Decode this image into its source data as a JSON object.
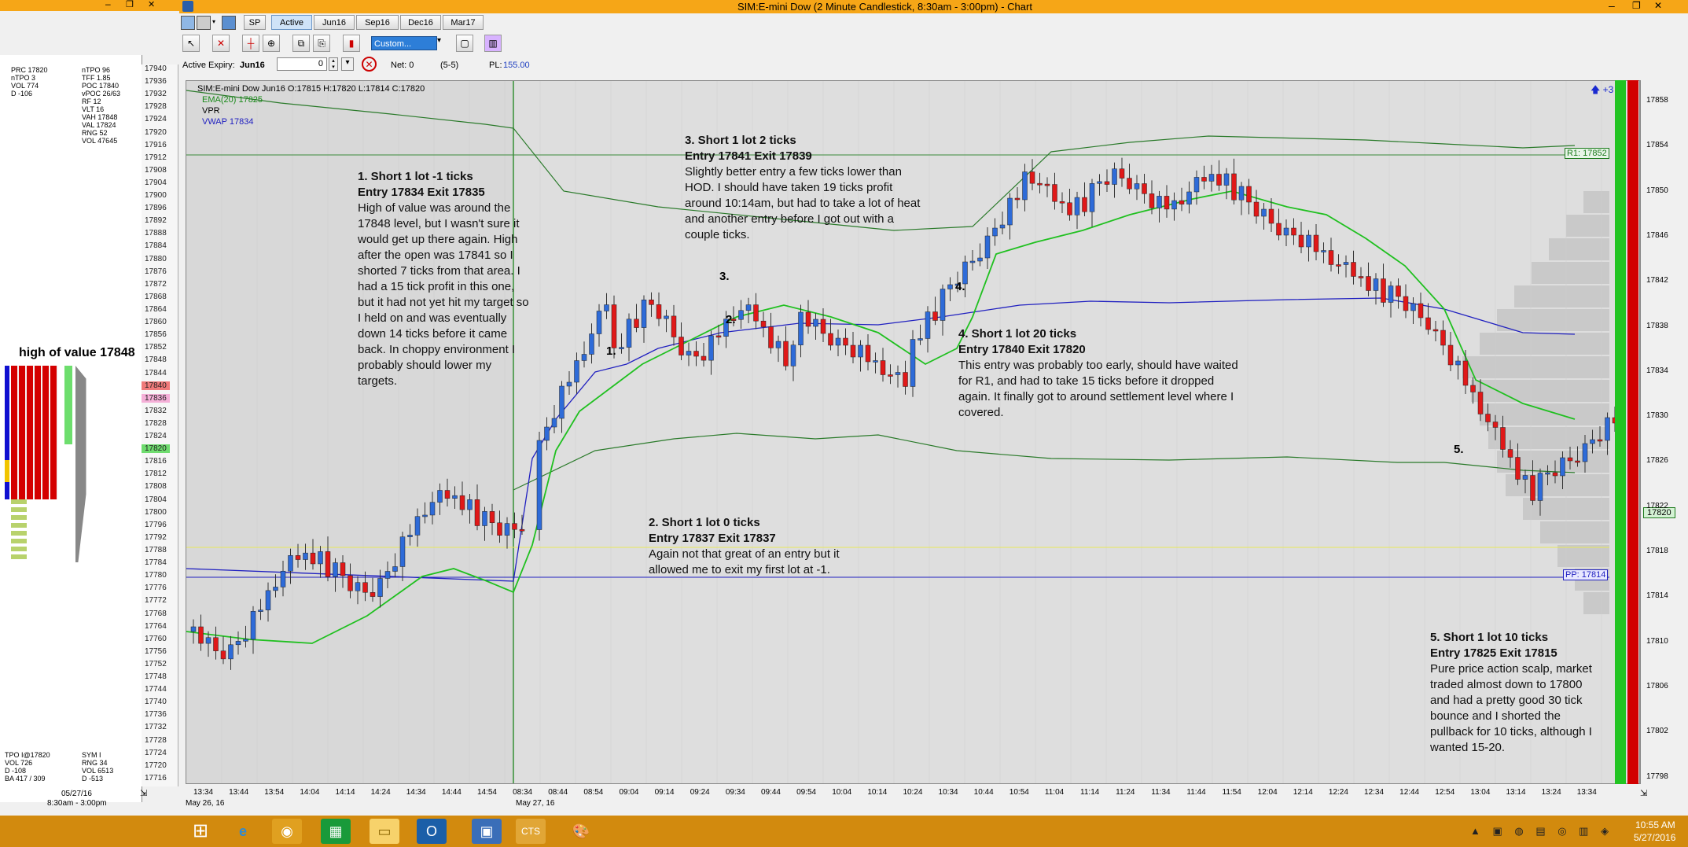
{
  "window": {
    "title": "SIM:E-mini Dow (2 Minute Candlestick, 8:30am - 3:00pm) - Chart"
  },
  "toolbar": {
    "symbol": "SP",
    "tabs": [
      "Active",
      "Jun16",
      "Sep16",
      "Dec16",
      "Mar17"
    ],
    "template_select": "Custom...",
    "active_expiry_label": "Active Expiry:",
    "active_expiry_value": "Jun16",
    "qty_value": "0",
    "net_label": "Net: 0",
    "position": "(5-5)",
    "pl_label": "PL:",
    "pl_value": "155.00"
  },
  "left_panel": {
    "stats_left": [
      "PRC  17820",
      "nTPO  3",
      "VOL  774",
      "D  -106"
    ],
    "stats_right": [
      "nTPO  96",
      "TFF  1.85",
      "POC  17840",
      "vPOC  26/63",
      "RF  12",
      "VLT  16",
      "VAH  17848",
      "VAL  17824",
      "RNG  52",
      "VOL  47645"
    ],
    "high_of_value": "high of value 17848",
    "bottom_left": [
      "TPO  I@17820",
      "VOL  726",
      "D  -108",
      "BA  417 / 309"
    ],
    "bottom_right": [
      "SYM  I",
      "RNG  34",
      "VOL  6513",
      "D  -513"
    ],
    "date": "05/27/16",
    "session": "8:30am - 3:00pm"
  },
  "ladder": {
    "prices": [
      "17940",
      "17936",
      "17932",
      "17928",
      "17924",
      "17920",
      "17916",
      "17912",
      "17908",
      "17904",
      "17900",
      "17896",
      "17892",
      "17888",
      "17884",
      "17880",
      "17876",
      "17872",
      "17868",
      "17864",
      "17860",
      "17856",
      "17852",
      "17848",
      "17844",
      "17840",
      "17836",
      "17832",
      "17828",
      "17824",
      "17820",
      "17816",
      "17812",
      "17808",
      "17804",
      "17800",
      "17796",
      "17792",
      "17788",
      "17784",
      "17780",
      "17776",
      "17772",
      "17768",
      "17764",
      "17760",
      "17756",
      "17752",
      "17748",
      "17744",
      "17740",
      "17736",
      "17732",
      "17728",
      "17724",
      "17720",
      "17716"
    ],
    "highlight_red": "17840",
    "highlight_pink": "17836",
    "highlight_green": "17820"
  },
  "chart_header": {
    "ohlc": "SIM:E-mini Dow Jun16 O:17815 H:17820 L:17814 C:17820",
    "ema": "EMA(20)  17825",
    "vpr": "VPR",
    "vwap": "VWAP  17834"
  },
  "price_axis": [
    "17858",
    "17854",
    "17850",
    "17846",
    "17842",
    "17838",
    "17834",
    "17830",
    "17826",
    "17822",
    "17818",
    "17814",
    "17810",
    "17806",
    "17802",
    "17798"
  ],
  "axis_badges": {
    "r1": "R1: 17852",
    "pp": "PP: 17814",
    "last": "17820"
  },
  "time_axis": [
    "13:34",
    "13:44",
    "13:54",
    "14:04",
    "14:14",
    "14:24",
    "14:34",
    "14:44",
    "14:54",
    "08:34",
    "08:44",
    "08:54",
    "09:04",
    "09:14",
    "09:24",
    "09:34",
    "09:44",
    "09:54",
    "10:04",
    "10:14",
    "10:24",
    "10:34",
    "10:44",
    "10:54",
    "11:04",
    "11:14",
    "11:24",
    "11:34",
    "11:44",
    "11:54",
    "12:04",
    "12:14",
    "12:24",
    "12:34",
    "12:44",
    "12:54",
    "13:04",
    "13:14",
    "13:24",
    "13:34"
  ],
  "date_labels": [
    "May 26, 16",
    "May 27, 16"
  ],
  "trade_markers": [
    "1.",
    "2.",
    "3.",
    "4.",
    "5."
  ],
  "annotations": [
    {
      "title": "1. Short 1 lot -1 ticks",
      "entry": "Entry 17834  Exit 17835",
      "body": "High of value was around the 17848 level, but I wasn't sure it would get up there again. High after the open was 17841 so I shorted 7 ticks from that area. I had a 15 tick profit in this one, but it had not yet hit my target so I held on and was eventually down 14 ticks before it came back. In choppy environment I probably should lower my targets."
    },
    {
      "title": "2. Short 1 lot  0 ticks",
      "entry": "Entry 17837 Exit 17837",
      "body": "Again not that great of an entry but it allowed me to exit my first lot at -1."
    },
    {
      "title": "3. Short 1 lot 2 ticks",
      "entry": "Entry 17841 Exit 17839",
      "body": "Slightly better entry a few ticks lower than HOD. I should have taken 19 ticks profit around 10:14am, but had to take a lot of heat and another entry before I got out with a couple ticks."
    },
    {
      "title": "4. Short 1 lot 20 ticks",
      "entry": "Entry 17840 Exit 17820",
      "body": "This entry was probably too early, should have waited for R1, and had to take 15 ticks before it dropped again. It finally got to around settlement level where I covered."
    },
    {
      "title": "5. Short 1 lot 10 ticks",
      "entry": "Entry 17825 Exit 17815",
      "body": "Pure price action scalp, market traded almost down to 17800 and had a pretty good 30 tick bounce and I shorted the pullback for 10 ticks, although I wanted 15-20."
    }
  ],
  "taskbar": {
    "time": "10:55 AM",
    "date": "5/27/2016"
  }
}
